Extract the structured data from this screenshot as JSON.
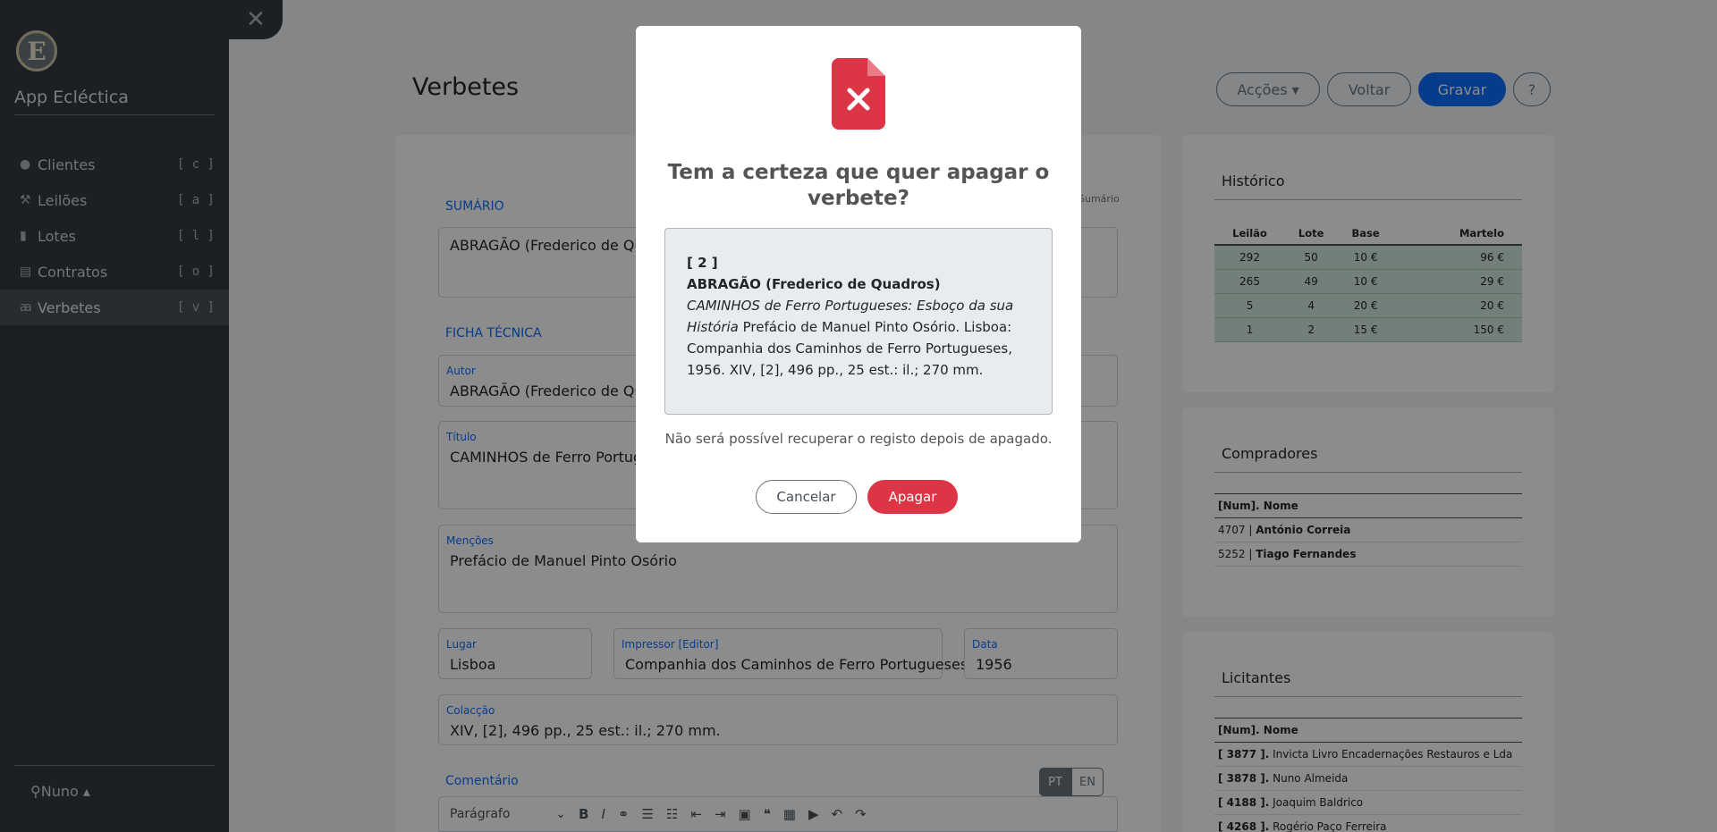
{
  "sidebar": {
    "logo_letter": "E",
    "app_title": "App Ecléctica",
    "items": [
      {
        "icon": "user-circle-icon",
        "glyph": "●",
        "label": "Clientes",
        "key": "[ c ]"
      },
      {
        "icon": "gavel-icon",
        "glyph": "⚒",
        "label": "Leilões",
        "key": "[ a ]"
      },
      {
        "icon": "book-icon",
        "glyph": "▮",
        "label": "Lotes",
        "key": "[ l ]"
      },
      {
        "icon": "contract-icon",
        "glyph": "▤",
        "label": "Contratos",
        "key": "[ o ]"
      },
      {
        "icon": "spell-check-icon",
        "glyph": "ꜳ",
        "label": "Verbetes",
        "key": "[ v ]"
      }
    ],
    "user": "Nuno ▴"
  },
  "header": {
    "title": "Verbetes",
    "actions_label": "Acções ▾",
    "back_label": "Voltar",
    "save_label": "Gravar",
    "help_label": "?"
  },
  "form": {
    "summary_title": "SUMÁRIO",
    "summary_hint": "Sumário",
    "summary_value": "ABRAGÃO (Frederico de Quadros) CAMINHOS de Ferro Portugueses ... 1956.",
    "sheet_title": "FICHA TÉCNICA",
    "author_label": "Autor",
    "author_value": "ABRAGÃO (Frederico de Quadros)",
    "title_label": "Título",
    "title_value": "CAMINHOS de Ferro Portugueses: Esboço da sua História",
    "mentions_label": "Menções",
    "mentions_value": "Prefácio de Manuel Pinto Osório",
    "place_label": "Lugar",
    "place_value": "Lisboa",
    "printer_label": "Impressor [Editor]",
    "printer_value": "Companhia dos Caminhos de Ferro Portugueses",
    "date_label": "Data",
    "date_value": "1956",
    "collation_label": "Colacção",
    "collation_value": "XIV, [2], 496 pp., 25 est.: il.; 270 mm.",
    "comment_label": "Comentário",
    "lang_pt": "PT",
    "lang_en": "EN",
    "editor_paragraph": "Parágrafo"
  },
  "history": {
    "title": "Histórico",
    "columns": [
      "Leilão",
      "Lote",
      "Base",
      "Martelo"
    ],
    "rows": [
      [
        "292",
        "50",
        "10 €",
        "96 €"
      ],
      [
        "265",
        "49",
        "10 €",
        "29 €"
      ],
      [
        "5",
        "4",
        "20 €",
        "20 €"
      ],
      [
        "1",
        "2",
        "15 €",
        "150 €"
      ]
    ]
  },
  "buyers": {
    "title": "Compradores",
    "header": "[Num]. Nome",
    "rows": [
      {
        "num": "4707 |",
        "name": "António Correia"
      },
      {
        "num": "5252 |",
        "name": "Tiago Fernandes"
      }
    ]
  },
  "bidders": {
    "title": "Licitantes",
    "header": "[Num]. Nome",
    "rows": [
      {
        "num": "[ 3877 ].",
        "name": "Invicta Livro Encadernações Restauros e Lda"
      },
      {
        "num": "[ 3878 ].",
        "name": "Nuno Almeida"
      },
      {
        "num": "[ 4188 ].",
        "name": "Joaquim Baldrico"
      },
      {
        "num": "[ 4268 ].",
        "name": "Rogério Paço Ferreira"
      }
    ]
  },
  "modal": {
    "icon": "file-delete-icon",
    "icon_color": "#dc3545",
    "title": "Tem a certeza que quer apagar o verbete?",
    "record_num": "[ 2 ]",
    "record_author": "ABRAGÃO (Frederico de Quadros)",
    "record_title": "CAMINHOS de Ferro Portugueses: Esboço da sua História",
    "record_rest": " Prefácio de Manuel Pinto Osório. Lisboa: Companhia dos Caminhos de Ferro Portugueses, 1956. XIV, [2], 496 pp., 25 est.: il.; 270 mm.",
    "warning": "Não será possível recuperar o registo depois de apagado.",
    "cancel_label": "Cancelar",
    "delete_label": "Apagar"
  }
}
